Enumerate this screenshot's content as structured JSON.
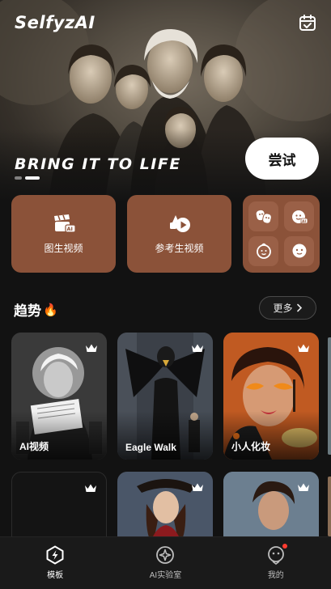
{
  "app": {
    "logo": "SelfyzAI"
  },
  "hero": {
    "title": "BRING IT TO LIFE",
    "try_label": "尝试",
    "slide_count": 2,
    "active_slide": 1
  },
  "features": [
    {
      "label": "图生视频",
      "icon": "image-to-video-icon"
    },
    {
      "label": "参考生视频",
      "icon": "reference-video-icon"
    }
  ],
  "mini_tools": [
    {
      "icon": "masks-swap-icon"
    },
    {
      "icon": "ai-face-icon"
    },
    {
      "icon": "baby-face-icon"
    },
    {
      "icon": "face-emoji-icon"
    }
  ],
  "trends": {
    "title": "趋势",
    "emoji": "🔥",
    "more_label": "更多",
    "cards": [
      {
        "caption": "AI视频",
        "premium": true
      },
      {
        "caption": "Eagle Walk",
        "premium": true
      },
      {
        "caption": "小人化妆",
        "premium": true
      },
      {
        "caption": "",
        "premium": true
      },
      {
        "caption": "",
        "premium": true
      },
      {
        "caption": "",
        "premium": true
      }
    ]
  },
  "nav": {
    "items": [
      {
        "label": "模板",
        "icon": "template-icon",
        "active": true
      },
      {
        "label": "AI实验室",
        "icon": "ai-lab-icon",
        "active": false
      },
      {
        "label": "我的",
        "icon": "profile-icon",
        "active": false,
        "badge": true
      }
    ]
  },
  "colors": {
    "background": "#121212",
    "feature_card": "#8b5239",
    "try_button": "#ffffff",
    "badge": "#ff3b30"
  }
}
